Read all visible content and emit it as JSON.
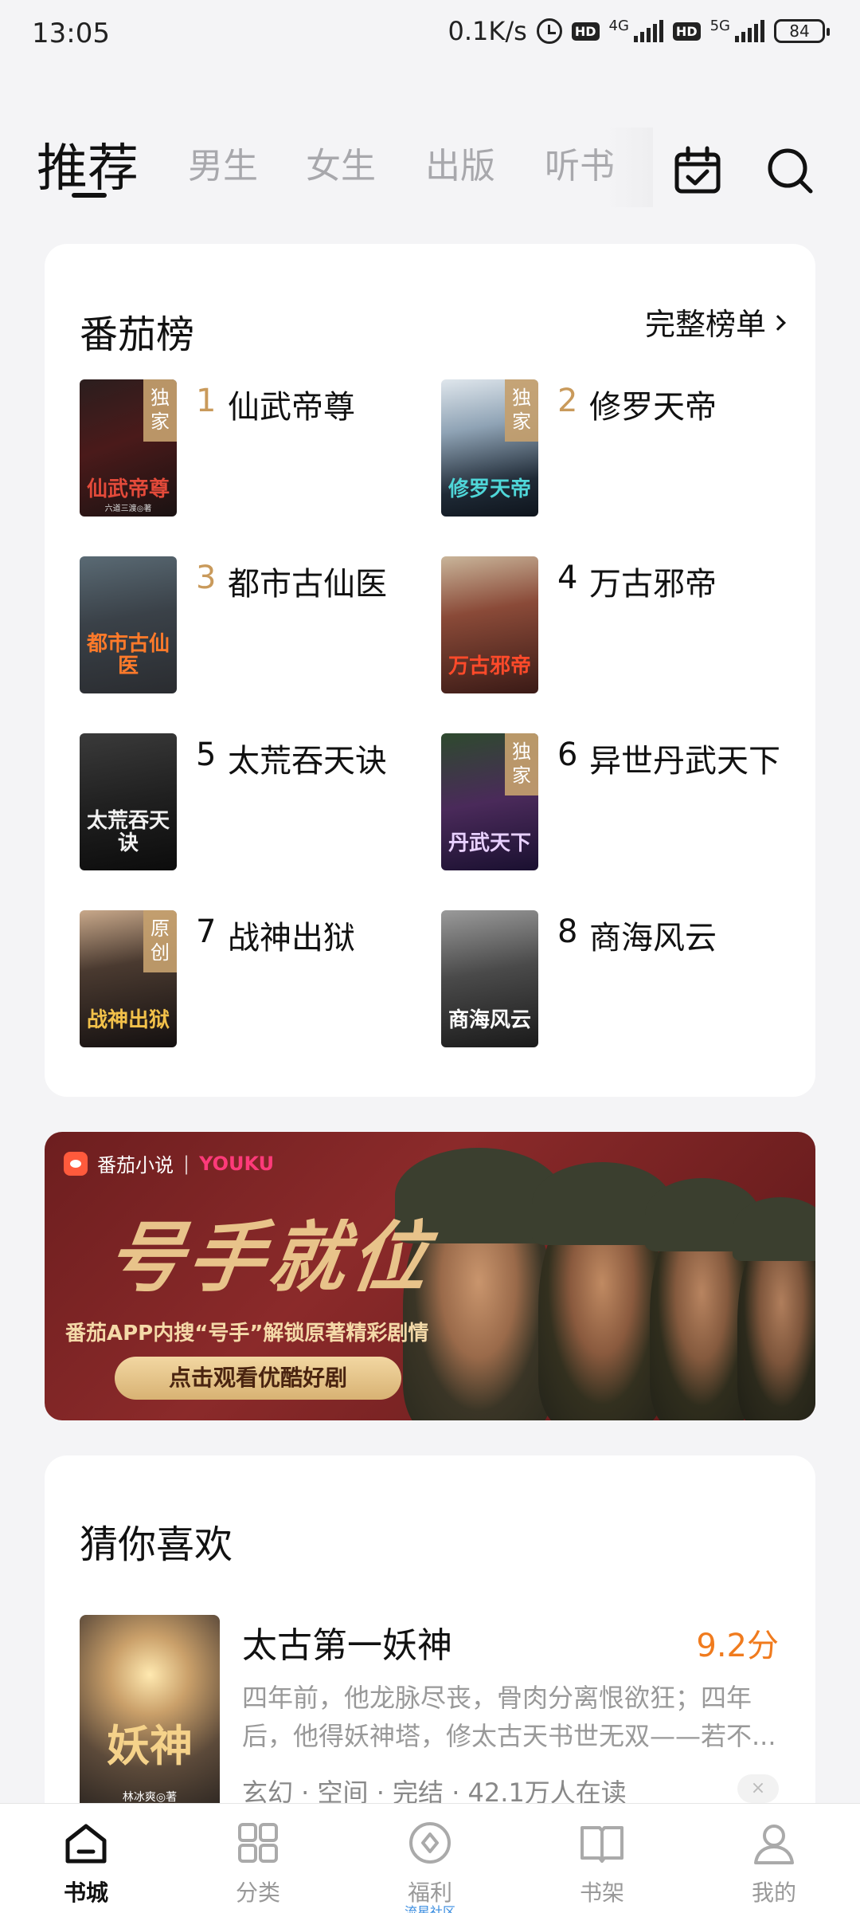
{
  "status_bar": {
    "time": "13:05",
    "net_speed": "0.1K/s",
    "hd1": "HD",
    "net1": "4G",
    "hd2": "HD",
    "net2": "5G",
    "battery": "84"
  },
  "top_nav": {
    "tabs": [
      {
        "label": "推荐",
        "active": true
      },
      {
        "label": "男生"
      },
      {
        "label": "女生"
      },
      {
        "label": "出版"
      },
      {
        "label": "听书"
      }
    ],
    "icons": [
      "calendar-check-icon",
      "search-icon"
    ]
  },
  "rank_card": {
    "title": "番茄榜",
    "more_label": "完整榜单",
    "items": [
      {
        "rank": "1",
        "name": "仙武帝尊",
        "badge": "独家",
        "cover_title": "仙武帝尊",
        "cover_author": "六道三渡◎著"
      },
      {
        "rank": "2",
        "name": "修罗天帝",
        "badge": "独家",
        "cover_title": "修罗天帝",
        "cover_author": ""
      },
      {
        "rank": "3",
        "name": "都市古仙医",
        "badge": "",
        "cover_title": "都市古仙医",
        "cover_author": ""
      },
      {
        "rank": "4",
        "name": "万古邪帝",
        "badge": "",
        "cover_title": "万古邪帝",
        "cover_author": ""
      },
      {
        "rank": "5",
        "name": "太荒吞天诀",
        "badge": "",
        "cover_title": "太荒吞天诀",
        "cover_author": ""
      },
      {
        "rank": "6",
        "name": "异世丹武天下",
        "badge": "独家",
        "cover_title": "丹武天下",
        "cover_author": ""
      },
      {
        "rank": "7",
        "name": "战神出狱",
        "badge": "原创",
        "cover_title": "战神出狱",
        "cover_author": ""
      },
      {
        "rank": "8",
        "name": "商海风云",
        "badge": "",
        "cover_title": "商海风云",
        "cover_author": ""
      }
    ]
  },
  "banner": {
    "app_name": "番茄小说",
    "partner": "YOUKU",
    "title": "号手就位",
    "subtitle": "番茄APP内搜“号手”解锁原著精彩剧情",
    "button": "点击观看优酷好剧"
  },
  "recommend": {
    "title": "猜你喜欢",
    "book": {
      "name": "太古第一妖神",
      "score": "9.2分",
      "description": "四年前，他龙脉尽丧，骨肉分离恨欲狂；四年后，他得妖神塔，修太古天书世无双——若不...",
      "meta": "玄幻 · 空间 · 完结 · 42.1万人在读",
      "cover_title": "妖神",
      "cover_author": "林冰爽◎著",
      "close": "×"
    }
  },
  "bottom_nav": {
    "items": [
      {
        "label": "书城",
        "icon": "home-icon",
        "active": true
      },
      {
        "label": "分类",
        "icon": "grid-icon"
      },
      {
        "label": "福利",
        "icon": "coin-icon",
        "sublabel": "流星社区"
      },
      {
        "label": "书架",
        "icon": "book-icon"
      },
      {
        "label": "我的",
        "icon": "user-icon"
      }
    ]
  },
  "colors": {
    "accent_orange": "#f07b1e",
    "rank_gold": "#c99a5b",
    "background": "#f4f4f6"
  }
}
